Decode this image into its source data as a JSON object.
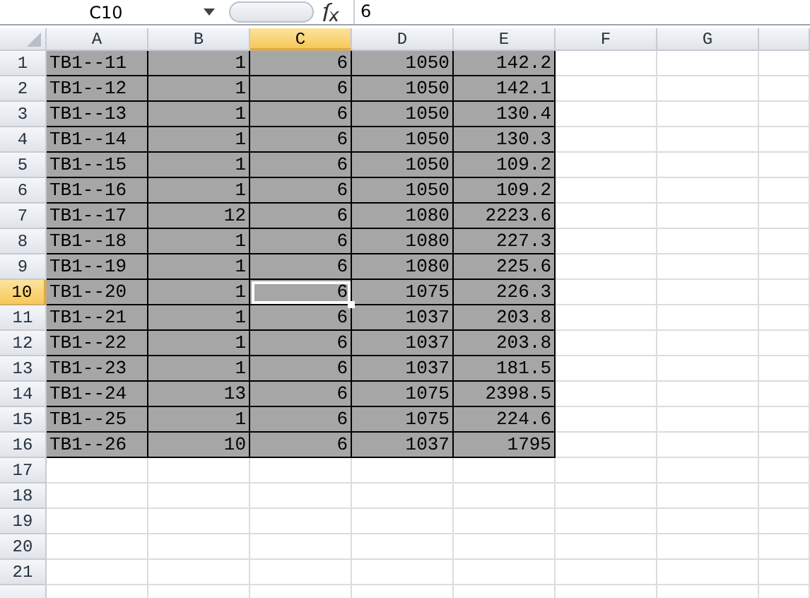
{
  "name_box": "C10",
  "formula": "6",
  "columns": [
    {
      "label": "A",
      "selected": false,
      "kind": "text"
    },
    {
      "label": "B",
      "selected": false,
      "kind": "number"
    },
    {
      "label": "C",
      "selected": true,
      "kind": "number"
    },
    {
      "label": "D",
      "selected": false,
      "kind": "number"
    },
    {
      "label": "E",
      "selected": false,
      "kind": "number"
    },
    {
      "label": "F",
      "selected": false,
      "kind": "number"
    },
    {
      "label": "G",
      "selected": false,
      "kind": "number"
    }
  ],
  "rows": [
    {
      "number": "1",
      "selected": false,
      "cells": [
        "TB1--11",
        "1",
        "6",
        "1050",
        "142.2"
      ]
    },
    {
      "number": "2",
      "selected": false,
      "cells": [
        "TB1--12",
        "1",
        "6",
        "1050",
        "142.1"
      ]
    },
    {
      "number": "3",
      "selected": false,
      "cells": [
        "TB1--13",
        "1",
        "6",
        "1050",
        "130.4"
      ]
    },
    {
      "number": "4",
      "selected": false,
      "cells": [
        "TB1--14",
        "1",
        "6",
        "1050",
        "130.3"
      ]
    },
    {
      "number": "5",
      "selected": false,
      "cells": [
        "TB1--15",
        "1",
        "6",
        "1050",
        "109.2"
      ]
    },
    {
      "number": "6",
      "selected": false,
      "cells": [
        "TB1--16",
        "1",
        "6",
        "1050",
        "109.2"
      ]
    },
    {
      "number": "7",
      "selected": false,
      "cells": [
        "TB1--17",
        "12",
        "6",
        "1080",
        "2223.6"
      ]
    },
    {
      "number": "8",
      "selected": false,
      "cells": [
        "TB1--18",
        "1",
        "6",
        "1080",
        "227.3"
      ]
    },
    {
      "number": "9",
      "selected": false,
      "cells": [
        "TB1--19",
        "1",
        "6",
        "1080",
        "225.6"
      ]
    },
    {
      "number": "10",
      "selected": true,
      "cells": [
        "TB1--20",
        "1",
        "6",
        "1075",
        "226.3"
      ]
    },
    {
      "number": "11",
      "selected": false,
      "cells": [
        "TB1--21",
        "1",
        "6",
        "1037",
        "203.8"
      ]
    },
    {
      "number": "12",
      "selected": false,
      "cells": [
        "TB1--22",
        "1",
        "6",
        "1037",
        "203.8"
      ]
    },
    {
      "number": "13",
      "selected": false,
      "cells": [
        "TB1--23",
        "1",
        "6",
        "1037",
        "181.5"
      ]
    },
    {
      "number": "14",
      "selected": false,
      "cells": [
        "TB1--24",
        "13",
        "6",
        "1075",
        "2398.5"
      ]
    },
    {
      "number": "15",
      "selected": false,
      "cells": [
        "TB1--25",
        "1",
        "6",
        "1075",
        "224.6"
      ]
    },
    {
      "number": "16",
      "selected": false,
      "cells": [
        "TB1--26",
        "10",
        "6",
        "1037",
        "1795"
      ]
    },
    {
      "number": "17",
      "selected": false
    },
    {
      "number": "18",
      "selected": false
    },
    {
      "number": "19",
      "selected": false
    },
    {
      "number": "20",
      "selected": false
    },
    {
      "number": "21",
      "selected": false
    }
  ]
}
